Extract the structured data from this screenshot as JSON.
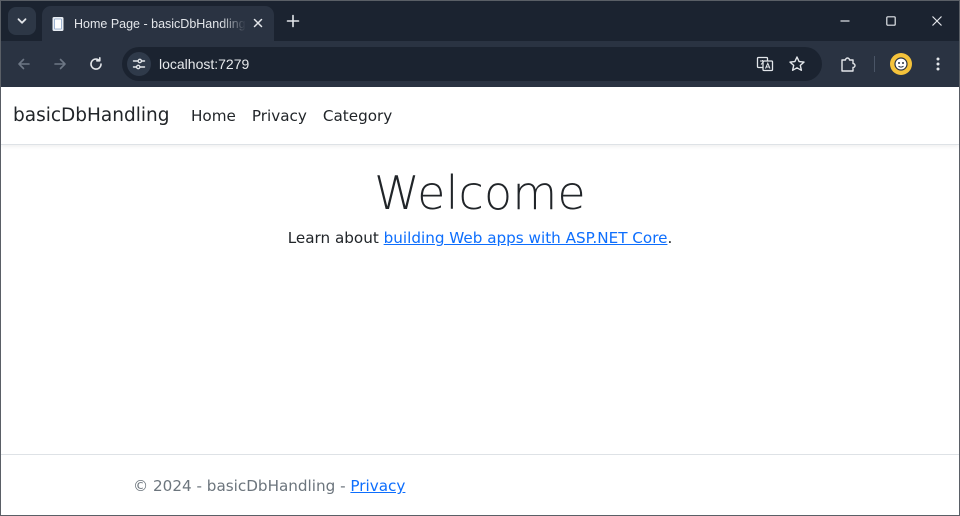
{
  "browser": {
    "tab_title": "Home Page - basicDbHandling",
    "url": "localhost:7279",
    "colors": {
      "frame": "#1b2330",
      "toolbar": "#2a3342",
      "avatar": "#f5c33b"
    },
    "icons": [
      "tab-search-icon",
      "favicon-icon",
      "close-icon",
      "plus-icon",
      "minimize-icon",
      "maximize-icon",
      "window-close-icon",
      "back-arrow-icon",
      "forward-arrow-icon",
      "reload-icon",
      "site-info-icon",
      "translate-icon",
      "star-icon",
      "extensions-icon",
      "profile-avatar",
      "more-vert-icon"
    ]
  },
  "site": {
    "brand": "basicDbHandling",
    "nav": [
      "Home",
      "Privacy",
      "Category"
    ],
    "hero": {
      "title": "Welcome",
      "lead": "Learn about ",
      "link_text": "building Web apps with ASP.NET Core",
      "trail": "."
    },
    "footer": {
      "copyright": "© 2024 - basicDbHandling - ",
      "privacy_link": "Privacy"
    },
    "colors": {
      "link": "#0d6efd",
      "text": "#212529",
      "muted": "#6c757d",
      "border": "#dee2e6"
    }
  }
}
